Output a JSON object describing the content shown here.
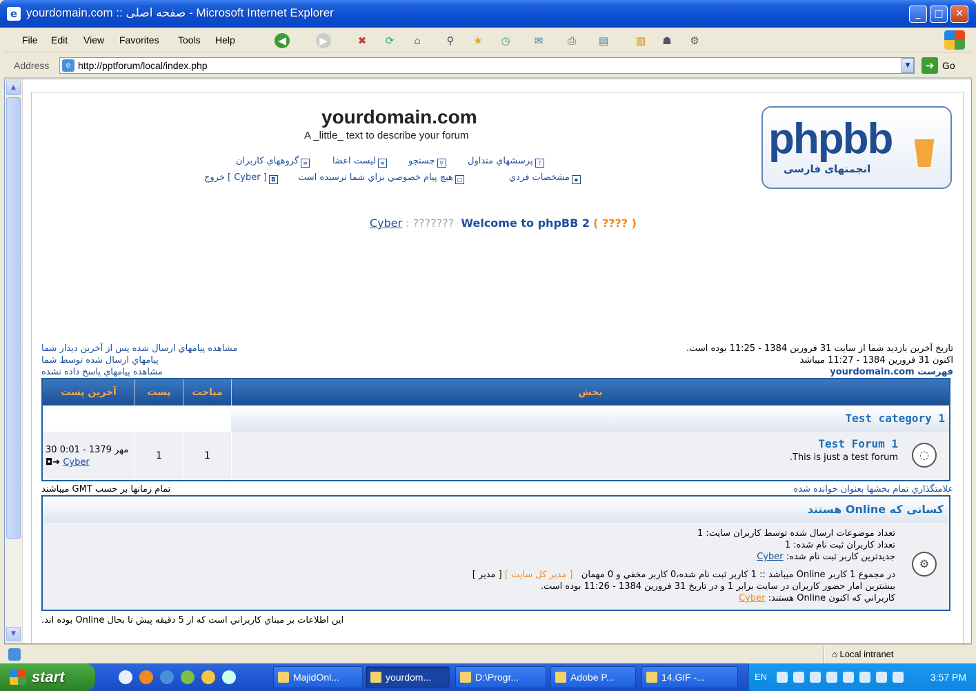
{
  "window": {
    "title": "yourdomain.com :: صفحه اصلی - Microsoft Internet Explorer",
    "minimize": "_",
    "maximize": "□",
    "close": "✕"
  },
  "menu": [
    "File",
    "Edit",
    "View",
    "Favorites",
    "Tools",
    "Help"
  ],
  "address": {
    "label": "Address",
    "url": "http://pptforum/local/index.php",
    "go": "Go"
  },
  "header": {
    "site_title": "yourdomain.com",
    "site_desc": "A _little_ text to describe your forum",
    "logo_text": "phpbb",
    "logo_sub": "انجمنهای فارسی"
  },
  "nav": {
    "faq": "پرسشهاي متداول",
    "search": "جستجو",
    "members": "ليست اعضا",
    "groups": "گروههاي كاربران",
    "profile": "مشخصات فردي",
    "pm": "هيچ پيام خصوصي براي شما نرسيده است",
    "logout": "[ Cyber ] خروج"
  },
  "welcome": {
    "user": "Cyber",
    "sep": " : ",
    "q1": "???????",
    "msg": "Welcome to phpBB 2",
    "paren": "( ???? )"
  },
  "info": {
    "last_visit": "تاريخ آخرين بازديد شما از سايت 31 فرورين 1384 - 11:25 بوده است.",
    "now": "اكنون 31 فرورين 1384 - 11:27 ميباشد",
    "index": "فهرست yourdomain.com",
    "new_posts": "مشاهده پيامهاي ارسال شده پس از آخرين ديدار شما",
    "your_posts": "پيامهاي ارسال شده توسط شما",
    "unanswered": "مشاهده پيامهاي پاسخ داده نشده"
  },
  "forum_table": {
    "headers": {
      "forum": "بخش",
      "topics": "مباحث",
      "posts": "پست",
      "last_post": "آخرين پست"
    },
    "category": "Test category 1",
    "row": {
      "name": "Test Forum 1",
      "desc": ".This is just a test forum",
      "topics": "1",
      "posts": "1",
      "last_post_date": "30 مهر 1379 - 0:01",
      "last_post_user": "Cyber",
      "last_post_arrow": "◘➔"
    }
  },
  "below_table": {
    "mark_read": "علامتگذاري تمام بخشها بعنوان خوانده شده",
    "timezone": "تمام زمانها بر حسب GMT ميباشند"
  },
  "online": {
    "title": "كسانى كه Online هستند",
    "total_posts": "تعداد موضوعات ارسال شده توسط كاربران سايت: 1",
    "total_users": "تعداد كاربران ثبت نام شده: 1",
    "newest_label": "جديدترين كاربر ثبت نام شده:",
    "newest_user": "Cyber",
    "users_online": "در مجموع 1 كاربر Online ميباشد :: 1 كاربر ثبت نام شده،0 كاربر مخفي و 0 مهمان",
    "admin_legend": "[ مدير كل سايت ]",
    "mod_legend": "[ مدير ]",
    "record": "بيشترين امار حضور كاربران در سايت برابر 1 و در تاريخ 31 فرورين 1384 - 11:26 بوده است.",
    "online_now_label": "كاربراني كه اكنون Online هستند:",
    "online_now_user": "Cyber",
    "footnote": "اين اطلاعات بر مبناي كاربراني است كه از 5 دقيقه پيش تا بحال Online بوده اند."
  },
  "status": {
    "zone": "Local intranet"
  },
  "taskbar": {
    "start": "start",
    "tasks": [
      "MajidOnl...",
      "yourdom...",
      "D:\\Progr...",
      "Adobe P...",
      "14.GIF -..."
    ],
    "lang": "EN",
    "clock": "3:57 PM"
  }
}
